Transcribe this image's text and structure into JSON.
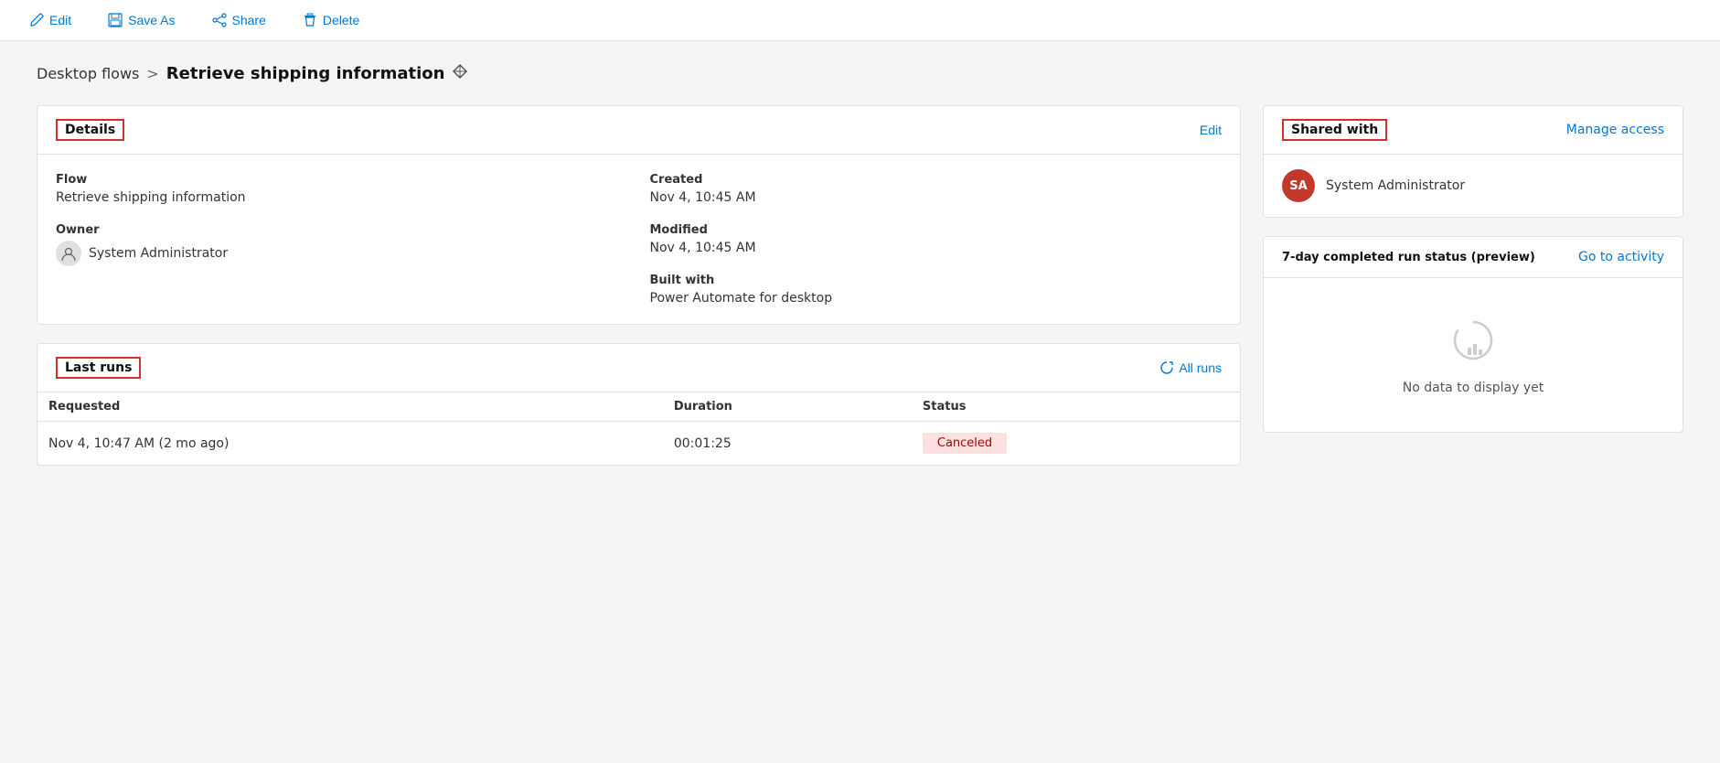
{
  "toolbar": {
    "edit_label": "Edit",
    "save_as_label": "Save As",
    "share_label": "Share",
    "delete_label": "Delete"
  },
  "breadcrumb": {
    "parent_label": "Desktop flows",
    "separator": ">",
    "current_label": "Retrieve shipping information"
  },
  "details_card": {
    "title": "Details",
    "edit_action": "Edit",
    "flow_label": "Flow",
    "flow_value": "Retrieve shipping information",
    "owner_label": "Owner",
    "owner_value": "System Administrator",
    "created_label": "Created",
    "created_value": "Nov 4, 10:45 AM",
    "modified_label": "Modified",
    "modified_value": "Nov 4, 10:45 AM",
    "built_with_label": "Built with",
    "built_with_value": "Power Automate for desktop"
  },
  "last_runs_card": {
    "title": "Last runs",
    "all_runs_label": "All runs",
    "columns": {
      "requested": "Requested",
      "duration": "Duration",
      "status": "Status"
    },
    "rows": [
      {
        "requested": "Nov 4, 10:47 AM (2 mo ago)",
        "duration": "00:01:25",
        "status": "Canceled"
      }
    ]
  },
  "shared_with_card": {
    "title": "Shared with",
    "manage_access_label": "Manage access",
    "users": [
      {
        "initials": "SA",
        "name": "System Administrator"
      }
    ]
  },
  "activity_card": {
    "title": "7-day completed run status (preview)",
    "go_to_activity_label": "Go to activity",
    "no_data_text": "No data to display yet"
  }
}
